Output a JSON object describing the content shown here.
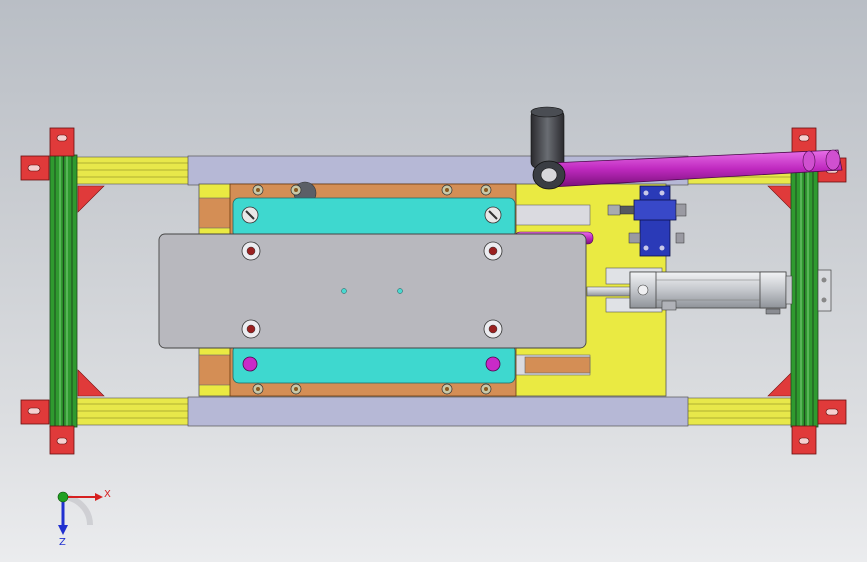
{
  "view": {
    "type": "cad-top-view",
    "background_gradient": [
      "#b9bec5",
      "#ebecee"
    ]
  },
  "colors": {
    "frame_green": "#2f9a2f",
    "frame_dark": "#1e4a1e",
    "rail_yellow": "#e8e84a",
    "foot_red": "#e03a3a",
    "plate_yellow": "#eaea42",
    "slider_orange": "#d48e55",
    "platen_cyan": "#3ed8cf",
    "top_plate_grey": "#b8b8be",
    "beam_lavender": "#b6b8d6",
    "handle_magenta": "#c82ac8",
    "clamp_blue": "#2a3ab8",
    "cylinder_silver": "#d0d3d8",
    "axis_x": "#d62020",
    "axis_y": "#20a020",
    "axis_z": "#2030d0"
  },
  "axis_triad": {
    "x_label": "X",
    "z_label": "Z"
  }
}
